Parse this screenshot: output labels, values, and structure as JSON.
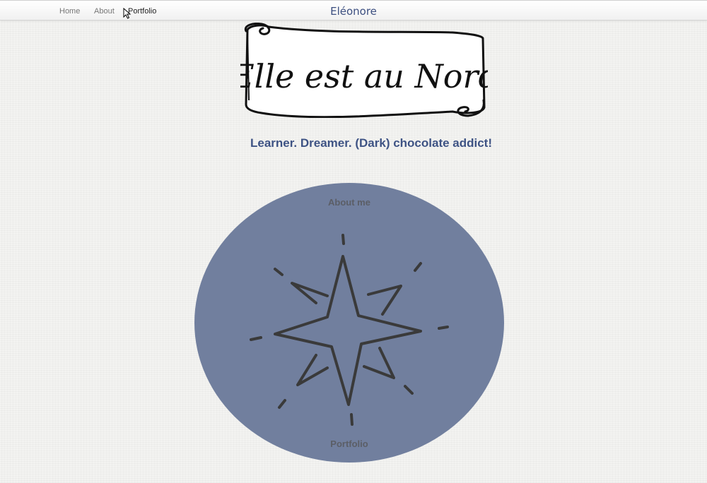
{
  "nav": {
    "links": [
      {
        "label": "Home"
      },
      {
        "label": "About"
      },
      {
        "label": "Portfolio"
      }
    ],
    "brand": "Eléonore"
  },
  "header": {
    "logo_text": "Elle est au Nord",
    "tagline": "Learner. Dreamer. (Dark) chocolate addict!"
  },
  "compass": {
    "top_link": "About me",
    "bottom_link": "Portfolio",
    "icon": "compass-star-icon"
  },
  "colors": {
    "accent": "#3e5384",
    "circle": "#717f9e",
    "background": "#f1f1ef"
  }
}
